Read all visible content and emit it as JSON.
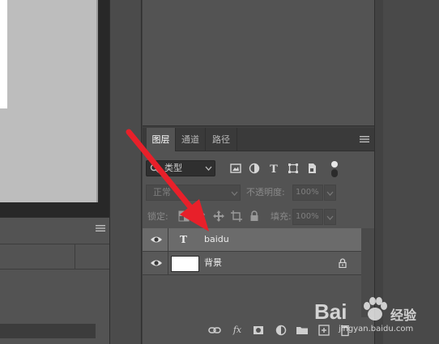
{
  "tabs": [
    {
      "label": "图层",
      "active": true
    },
    {
      "label": "通道",
      "active": false
    },
    {
      "label": "路径",
      "active": false
    }
  ],
  "filter": {
    "kind": "类型"
  },
  "blend": {
    "mode": "正常"
  },
  "opacity": {
    "label": "不透明度:",
    "value": "100%"
  },
  "lock": {
    "label": "锁定:"
  },
  "fill": {
    "label": "填充:",
    "value": "100%"
  },
  "layers": [
    {
      "name": "baidu",
      "type_icon": "T",
      "selected": true,
      "visible": true
    },
    {
      "name": "背景",
      "selected": false,
      "visible": true,
      "locked": true
    }
  ],
  "bottom_icons": [
    "link-icon",
    "fx-icon",
    "mask-icon",
    "adjustment-icon",
    "folder-icon",
    "new-layer-icon",
    "trash-icon"
  ],
  "fx_label": "fx",
  "watermark": {
    "brand": "Bai",
    "brand_suffix": "经验",
    "url": "jingyan.baidu.com"
  },
  "colors": {
    "panel": "#535353",
    "tab_bar": "#3a3a3a",
    "selected_row": "#6b6b6b",
    "arrow": "#e8202a"
  }
}
